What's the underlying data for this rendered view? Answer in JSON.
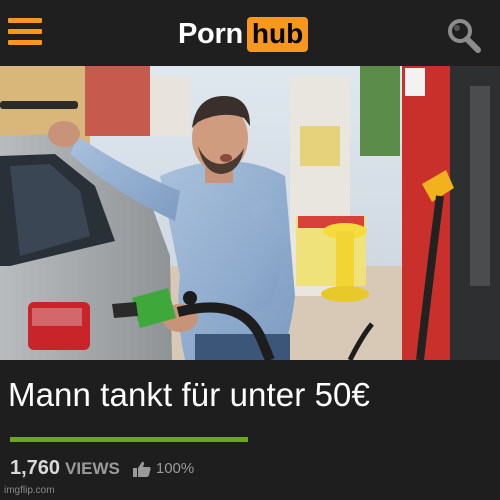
{
  "header": {
    "menu_icon": "hamburger-menu-icon",
    "logo": {
      "left_text": "Porn",
      "right_text": "hub"
    },
    "search_icon": "search-icon"
  },
  "video": {
    "thumbnail": "man-refueling-car-photo",
    "title": "Mann tankt für unter 50€",
    "rating_fraction": 1.0,
    "views_count": "1,760",
    "views_label": "VIEWS",
    "rating_icon": "thumbs-up-icon",
    "rating_text": "100%"
  },
  "watermark": "imgflip.com",
  "colors": {
    "background": "#1e1e1e",
    "header_bg": "#1f1f1f",
    "accent_orange": "#f7971d",
    "rating_green": "#6aa81a",
    "text_white": "#ffffff",
    "text_gray": "#9a9a9a"
  }
}
